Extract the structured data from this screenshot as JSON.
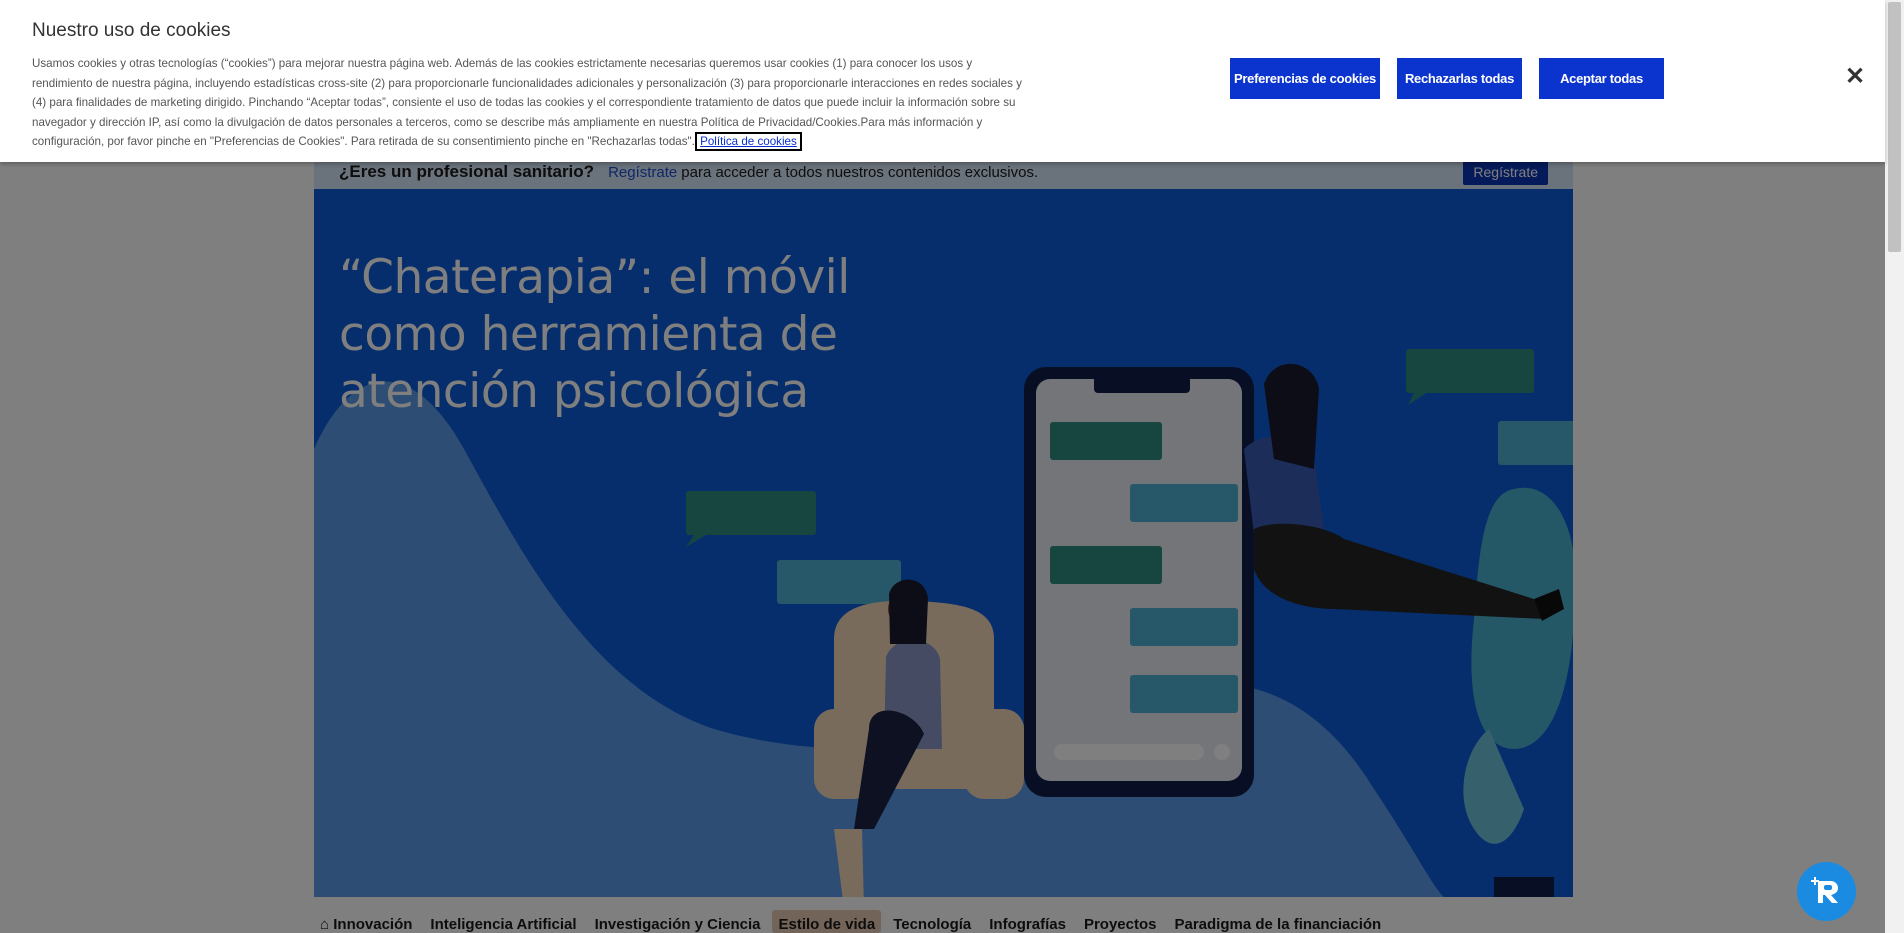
{
  "cookie_banner": {
    "title": "Nuestro uso de cookies",
    "description": "Usamos cookies y otras tecnologías (“cookies”) para mejorar nuestra página web. Además de las cookies estrictamente necesarias queremos usar cookies (1) para conocer los usos y rendimiento de nuestra página, incluyendo estadísticas cross-site (2) para proporcionarle funcionalidades adicionales y personalización (3) para proporcionarle interacciones en redes sociales y (4) para finalidades de marketing dirigido. Pinchando “Aceptar todas”, consiente el uso de todas las cookies y el correspondiente tratamiento de datos que puede incluir la información sobre su navegador y dirección IP, así como la divulgación de datos personales a terceros, como se describe más ampliamente en nuestra Política de Privacidad/Cookies.Para más información y configuración, por favor pinche en \"Preferencias de Cookies\". Para retirada de su consentimiento pinche en \"Rechazarlas todas\".",
    "policy_link": "Política de cookies",
    "buttons": {
      "preferences": "Preferencias de cookies",
      "reject_all": "Rechazarlas todas",
      "accept_all": "Aceptar todas"
    },
    "close_icon": "close-icon",
    "button_color": "#0b34cf"
  },
  "register_bar": {
    "question": "¿Eres un profesional sanitario?",
    "link": "Regístrate",
    "rest": "para acceder a todos nuestros contenidos exclusivos.",
    "button": "Regístrate"
  },
  "hero": {
    "title": "“Chaterapia”: el móvil como herramienta de atención psicológica"
  },
  "nav": {
    "items": [
      {
        "label": "Innovación",
        "icon": "home-icon"
      },
      {
        "label": "Inteligencia Artificial"
      },
      {
        "label": "Investigación y Ciencia"
      },
      {
        "label": "Estilo de vida"
      },
      {
        "label": "Tecnología"
      },
      {
        "label": "Infografías"
      },
      {
        "label": "Proyectos"
      },
      {
        "label": "Paradigma de la financiación"
      }
    ],
    "active": "Estilo de vida"
  },
  "chat_widget": {
    "icon": "chat-assistant-icon"
  }
}
